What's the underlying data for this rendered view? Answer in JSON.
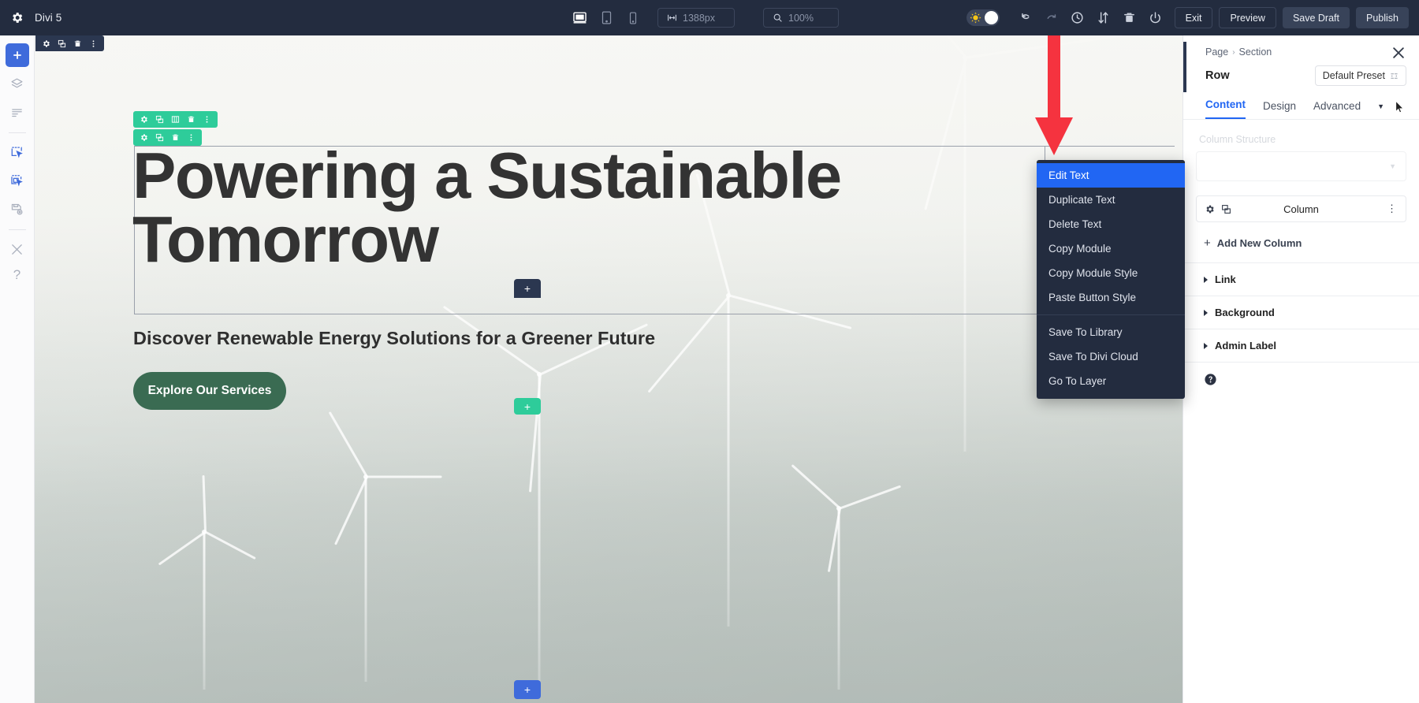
{
  "topbar": {
    "gear_icon": "gear-icon",
    "title": "Divi 5",
    "viewports": [
      {
        "name": "desktop",
        "icon": "desktop-icon",
        "active": true
      },
      {
        "name": "tablet",
        "icon": "tablet-icon",
        "active": false
      },
      {
        "name": "phone",
        "icon": "phone-icon",
        "active": false
      }
    ],
    "width_value": "1388px",
    "width_icon": "width-arrows-icon",
    "zoom_value": "100%",
    "zoom_icon": "magnifier-icon",
    "toggle_icon": "sun-gear-icon",
    "actions": [
      {
        "name": "undo",
        "icon": "undo-arrow-icon"
      },
      {
        "name": "redo",
        "icon": "redo-arrow-icon"
      },
      {
        "name": "history",
        "icon": "clock-icon"
      },
      {
        "name": "sort",
        "icon": "sort-arrows-icon"
      },
      {
        "name": "trash",
        "icon": "trash-icon"
      },
      {
        "name": "power",
        "icon": "power-icon"
      }
    ],
    "exit_label": "Exit",
    "preview_label": "Preview",
    "save_draft_label": "Save Draft",
    "publish_label": "Publish"
  },
  "sidebar": {
    "items": [
      {
        "name": "add",
        "icon": "plus-icon"
      },
      {
        "name": "layers",
        "icon": "layers-icon"
      },
      {
        "name": "list",
        "icon": "list-icon"
      },
      {
        "name": "select-element",
        "icon": "click-select-icon"
      },
      {
        "name": "multi-select",
        "icon": "multi-select-icon"
      },
      {
        "name": "save-library",
        "icon": "save-disk-icon"
      },
      {
        "name": "tools",
        "icon": "wrench-screwdriver-icon"
      },
      {
        "name": "help",
        "icon": "question-mark-icon",
        "glyph": "?"
      }
    ]
  },
  "canvas": {
    "section_toolbar_icons": [
      "gear-icon",
      "duplicate-icon",
      "trash-icon",
      "more-dots-icon"
    ],
    "row_toolbar_icons": [
      "gear-icon",
      "duplicate-icon",
      "columns-icon",
      "trash-icon",
      "more-dots-icon"
    ],
    "module_toolbar_icons": [
      "gear-icon",
      "duplicate-icon",
      "trash-icon",
      "more-dots-icon"
    ],
    "headline": "Powering a Sustainable Tomorrow",
    "subheadline": "Discover Renewable Energy Solutions for a Greener Future",
    "cta_label": "Explore Our Services",
    "plus_dark": "+",
    "plus_green": "+",
    "plus_blue": "+",
    "colors": {
      "green_toolbar": "#2ecc9a",
      "blue_toolbar": "#2b3750",
      "blue_add": "#3f6bdb",
      "cta_green": "#3a6b52",
      "annotation_red": "#f5333f"
    }
  },
  "context_menu": {
    "items": [
      {
        "label": "Edit Text",
        "selected": true
      },
      {
        "label": "Duplicate Text",
        "selected": false
      },
      {
        "label": "Delete Text",
        "selected": false
      },
      {
        "label": "Copy Module",
        "selected": false
      },
      {
        "label": "Copy Module Style",
        "selected": false
      },
      {
        "label": "Paste Button Style",
        "selected": false
      }
    ],
    "items_group2": [
      {
        "label": "Save To Library"
      },
      {
        "label": "Save To Divi Cloud"
      },
      {
        "label": "Go To Layer"
      }
    ]
  },
  "panel": {
    "breadcrumb_root": "Page",
    "breadcrumb_sep": "›",
    "breadcrumb_current": "Section",
    "close_icon": "close-icon",
    "row_title": "Row",
    "preset_label": "Default Preset",
    "preset_icon": "preset-icon",
    "tabs": [
      {
        "label": "Content",
        "active": true
      },
      {
        "label": "Design",
        "active": false
      },
      {
        "label": "Advanced",
        "active": false
      }
    ],
    "tab_caret_icon": "chevron-down-icon",
    "cursor_icon": "mouse-cursor-icon",
    "column_structure_label": "Column Structure",
    "column_card": {
      "gear_icon": "gear-icon",
      "duplicate_icon": "duplicate-icon",
      "label": "Column",
      "more_icon": "more-dots-icon"
    },
    "add_new_column_label": "Add New Column",
    "add_new_column_plus": "+",
    "accordions": [
      {
        "label": "Link"
      },
      {
        "label": "Background"
      },
      {
        "label": "Admin Label"
      }
    ],
    "help_icon": "help-circle-icon"
  }
}
